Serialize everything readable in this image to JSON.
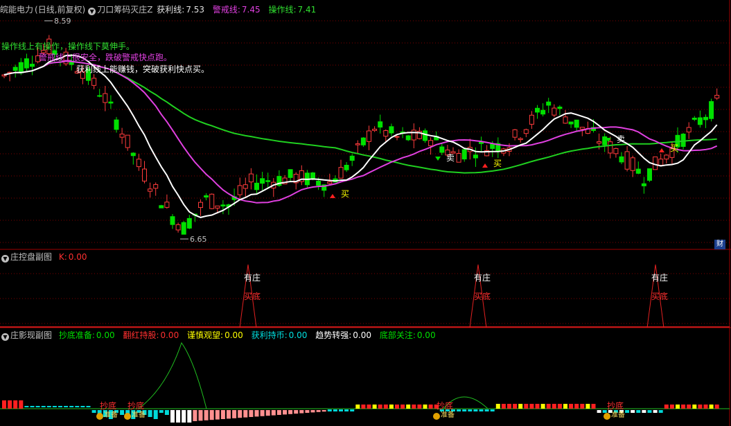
{
  "main": {
    "stock": "皖能电力",
    "period": "(日线,前复权)",
    "indicator": "刀口筹码灭庄Z",
    "profit_label": "获利线:",
    "profit_value": "7.53",
    "warn_label": "警戒线:",
    "warn_value": "7.45",
    "op_label": "操作线:",
    "op_value": "7.41",
    "tip1": "操作线上有操作，操作线下莫伸手。",
    "tip2": "警戒线上很安全，跌破警戒快点跑。",
    "tip3": "获利线上能赚钱，突破获利快点买。",
    "high_label": "8.59",
    "low_label": "6.65",
    "buy_label": "买",
    "sell_label": "卖",
    "cai_label": "财"
  },
  "sub1": {
    "title": "庄控盘副图",
    "k_label": "K:",
    "k_value": "0.00",
    "marker_top": "有庄",
    "marker_bottom": "买底"
  },
  "sub2": {
    "title": "庄影现副图",
    "items": [
      {
        "label": "抄底准备:",
        "value": "0.00",
        "color": "#00e000"
      },
      {
        "label": "翻红持股:",
        "value": "0.00",
        "color": "#ff3030"
      },
      {
        "label": "谨慎观望:",
        "value": "0.00",
        "color": "#ffff00"
      },
      {
        "label": "获利持币:",
        "value": "0.00",
        "color": "#00e0e0"
      },
      {
        "label": "趋势转强:",
        "value": "0.00",
        "color": "#ffffff"
      },
      {
        "label": "底部关注:",
        "value": "0.00",
        "color": "#00e000"
      }
    ],
    "bottom_label": "抄底",
    "bag_label": "准备"
  },
  "colors": {
    "up": "#ff3c3c",
    "down": "#00e000",
    "white_line": "#ffffff",
    "magenta_line": "#e040e0",
    "green_line": "#20d020",
    "grid": "#800000"
  }
}
